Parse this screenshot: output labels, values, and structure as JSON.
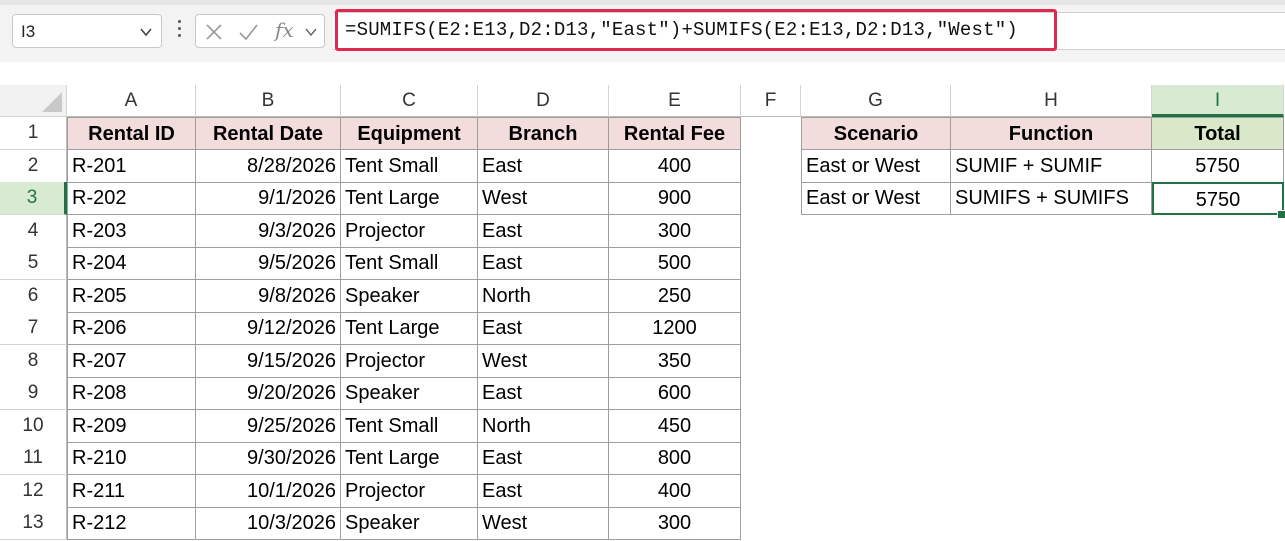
{
  "name_box": {
    "value": "I3"
  },
  "formula_bar": {
    "cancel_icon": "x-icon",
    "enter_icon": "check-icon",
    "fx_label": "fx",
    "formula": "=SUMIFS(E2:E13,D2:D13,\"East\")+SUMIFS(E2:E13,D2:D13,\"West\")",
    "highlight_color": "#e0284e"
  },
  "column_headers": [
    "A",
    "B",
    "C",
    "D",
    "E",
    "F",
    "G",
    "H",
    "I"
  ],
  "selected_column": "I",
  "row_headers": [
    "1",
    "2",
    "3",
    "4",
    "5",
    "6",
    "7",
    "8",
    "9",
    "10",
    "11",
    "12",
    "13"
  ],
  "selected_row": "3",
  "rental_table": {
    "headers": [
      "Rental ID",
      "Rental Date",
      "Equipment",
      "Branch",
      "Rental Fee"
    ],
    "rows": [
      [
        "R-201",
        "8/28/2026",
        "Tent Small",
        "East",
        "400"
      ],
      [
        "R-202",
        "9/1/2026",
        "Tent Large",
        "West",
        "900"
      ],
      [
        "R-203",
        "9/3/2026",
        "Projector",
        "East",
        "300"
      ],
      [
        "R-204",
        "9/5/2026",
        "Tent Small",
        "East",
        "500"
      ],
      [
        "R-205",
        "9/8/2026",
        "Speaker",
        "North",
        "250"
      ],
      [
        "R-206",
        "9/12/2026",
        "Tent Large",
        "East",
        "1200"
      ],
      [
        "R-207",
        "9/15/2026",
        "Projector",
        "West",
        "350"
      ],
      [
        "R-208",
        "9/20/2026",
        "Speaker",
        "East",
        "600"
      ],
      [
        "R-209",
        "9/25/2026",
        "Tent Small",
        "North",
        "450"
      ],
      [
        "R-210",
        "9/30/2026",
        "Tent Large",
        "East",
        "800"
      ],
      [
        "R-211",
        "10/1/2026",
        "Projector",
        "East",
        "400"
      ],
      [
        "R-212",
        "10/3/2026",
        "Speaker",
        "West",
        "300"
      ]
    ]
  },
  "summary_table": {
    "headers": [
      "Scenario",
      "Function",
      "Total"
    ],
    "rows": [
      [
        "East or West",
        "SUMIF + SUMIF",
        "5750"
      ],
      [
        "East or West",
        "SUMIFS + SUMIFS",
        "5750"
      ]
    ]
  },
  "colors": {
    "header_pink": "#f2dcdc",
    "header_green": "#d9e8c8",
    "selection_green": "#217346"
  }
}
